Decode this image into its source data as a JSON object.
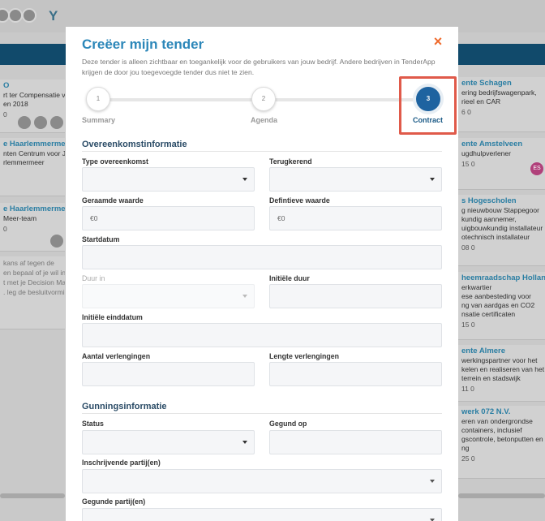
{
  "background": {
    "left_cards": [
      {
        "title": "O",
        "lines": [
          "rt ter Compensatie va",
          "en 2018"
        ],
        "meta": "0",
        "avatars": 3
      },
      {
        "title": "e Haarlemmermeer",
        "lines": [
          "nten Centrum voor Je",
          "rlemmermeer"
        ],
        "meta": "",
        "avatars": 0
      },
      {
        "title": "e Haarlemmermeer",
        "lines": [
          "Meer-team"
        ],
        "meta": "0",
        "avatars": 1
      },
      {
        "title": "",
        "lines": [
          "kans af tegen de",
          "en bepaal of je wil ins",
          "t met je Decision Mak",
          ". leg de besluitvormin"
        ],
        "meta": "",
        "avatars": 0
      }
    ],
    "right_cards": [
      {
        "title": "ente Schagen",
        "lines": [
          "ering bedrijfswagenpark,",
          "rieel en CAR"
        ],
        "meta": "6 0"
      },
      {
        "title": "ente Amstelveen",
        "lines": [
          "ugdhulpverlener"
        ],
        "meta": "15 0",
        "chip": "ES"
      },
      {
        "title": "s Hogescholen",
        "lines": [
          "g nieuwbouw Stappegoor",
          "kundig aannemer,",
          "uigbouwkundig installateur",
          "otechnisch installateur"
        ],
        "meta": "08 0"
      },
      {
        "title": "heemraadschap Hollands",
        "lines": [
          "erkwartier",
          "ese aanbesteding voor",
          "ng van aardgas en CO2",
          "nsatie certificaten"
        ],
        "meta": "15 0"
      },
      {
        "title": "ente Almere",
        "lines": [
          "werkingspartner voor het",
          "kelen en realiseren van het",
          "terrein en stadswijk"
        ],
        "meta": "11 0"
      },
      {
        "title": "werk 072 N.V.",
        "lines": [
          "eren van ondergrondse",
          "containers, inclusief",
          "gscontrole, betonputten en",
          "ng"
        ],
        "meta": "25 0"
      }
    ]
  },
  "modal": {
    "title": "Creëer mijn tender",
    "description": "Deze tender is alleen zichtbaar en toegankelijk voor de gebruikers van jouw bedrijf. Andere bedrijven in TenderApp krijgen de door jou toegevoegde tender dus niet te zien.",
    "close_icon": "×",
    "steps": [
      {
        "number": "1",
        "label": "Summary",
        "active": false
      },
      {
        "number": "2",
        "label": "Agenda",
        "active": false
      },
      {
        "number": "3",
        "label": "Contract",
        "active": true
      }
    ],
    "section_contract": "Overeenkomstinformatie",
    "fields": {
      "type_overeenkomst": {
        "label": "Type overeenkomst",
        "value": ""
      },
      "terugkerend": {
        "label": "Terugkerend",
        "value": ""
      },
      "geraamde_waarde": {
        "label": "Geraamde waarde",
        "value": "€0"
      },
      "definitieve_waarde": {
        "label": "Defintieve waarde",
        "value": "€0"
      },
      "startdatum": {
        "label": "Startdatum",
        "value": ""
      },
      "duur_in": {
        "label": "Duur in",
        "value": ""
      },
      "initiele_duur": {
        "label": "Initiële duur",
        "value": ""
      },
      "initiele_einddatum": {
        "label": "Initiële einddatum",
        "value": ""
      },
      "aantal_verlengingen": {
        "label": "Aantal verlengingen",
        "value": ""
      },
      "lengte_verlengingen": {
        "label": "Lengte verlengingen",
        "value": ""
      }
    },
    "section_award": "Gunningsinformatie",
    "award_fields": {
      "status": {
        "label": "Status",
        "value": ""
      },
      "gegund_op": {
        "label": "Gegund op",
        "value": ""
      },
      "inschrijvende": {
        "label": "Inschrijvende partij(en)",
        "value": ""
      },
      "gegunde": {
        "label": "Gegunde partij(en)",
        "value": ""
      }
    }
  },
  "colors": {
    "accent": "#2c87b9",
    "close": "#ef6a2c",
    "step_active": "#1e63a0",
    "highlight": "#e05a4a"
  }
}
